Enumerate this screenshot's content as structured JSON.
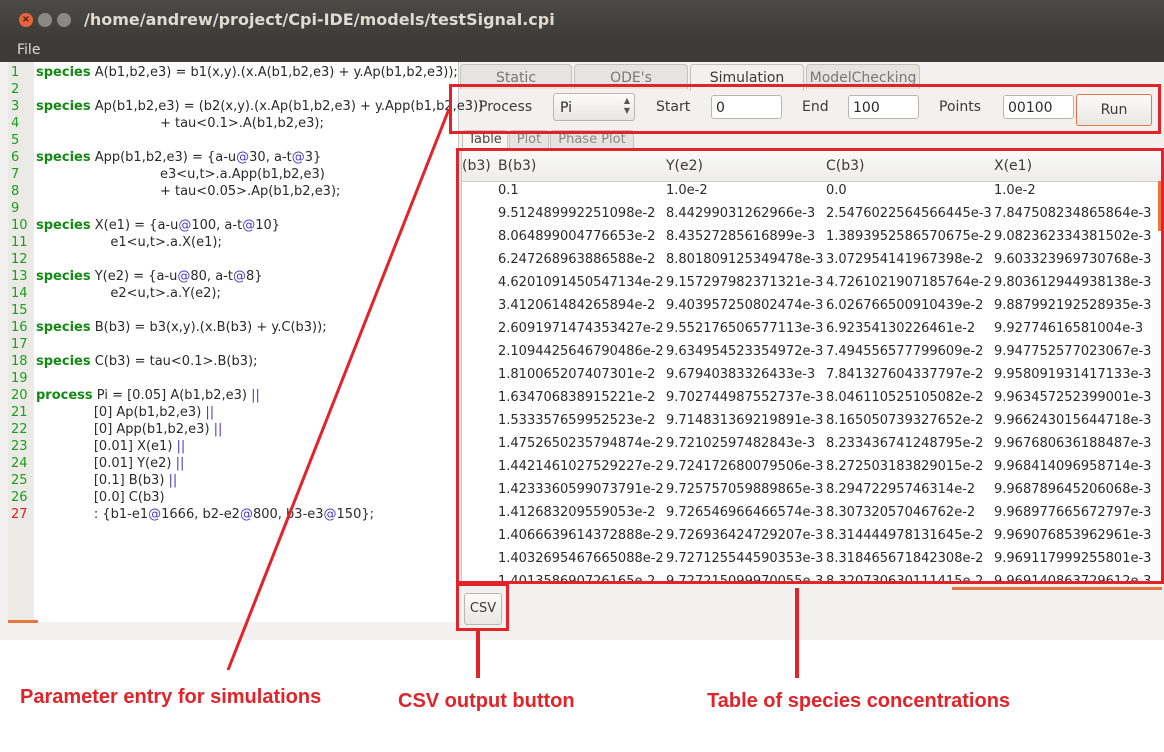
{
  "window": {
    "title": "/home/andrew/project/Cpi-IDE/models/testSignal.cpi",
    "menu": [
      "File"
    ]
  },
  "editor": {
    "lines": [
      {
        "n": "1",
        "html": "<span class='kw'>species</span> A(b1,b2,e3) = b1(x,y).(x.A(b1,b2,e3) + y.Ap(b1,b2,e3));"
      },
      {
        "n": "2",
        "html": ""
      },
      {
        "n": "3",
        "html": "<span class='kw'>species</span> Ap(b1,b2,e3) = (b2(x,y).(x.Ap(b1,b2,e3) + y.App(b1,b2,e3))"
      },
      {
        "n": "4",
        "html": "                              + tau&lt;0.1&gt;.A(b1,b2,e3);"
      },
      {
        "n": "5",
        "html": ""
      },
      {
        "n": "6",
        "html": "<span class='kw'>species</span> App(b1,b2,e3) = {a-u<span class='op'>@</span>30, a-t<span class='op'>@</span>3}"
      },
      {
        "n": "7",
        "html": "                              e3&lt;u,t&gt;.a.App(b1,b2,e3)"
      },
      {
        "n": "8",
        "html": "                              + tau&lt;0.05&gt;.Ap(b1,b2,e3);"
      },
      {
        "n": "9",
        "html": ""
      },
      {
        "n": "10",
        "html": "<span class='kw'>species</span> X(e1) = {a-u<span class='op'>@</span>100, a-t<span class='op'>@</span>10}"
      },
      {
        "n": "11",
        "html": "                  e1&lt;u,t&gt;.a.X(e1);"
      },
      {
        "n": "12",
        "html": ""
      },
      {
        "n": "13",
        "html": "<span class='kw'>species</span> Y(e2) = {a-u<span class='op'>@</span>80, a-t<span class='op'>@</span>8}"
      },
      {
        "n": "14",
        "html": "                  e2&lt;u,t&gt;.a.Y(e2);"
      },
      {
        "n": "15",
        "html": ""
      },
      {
        "n": "16",
        "html": "<span class='kw'>species</span> B(b3) = b3(x,y).(x.B(b3) + y.C(b3));"
      },
      {
        "n": "17",
        "html": ""
      },
      {
        "n": "18",
        "html": "<span class='kw'>species</span> C(b3) = tau&lt;0.1&gt;.B(b3);"
      },
      {
        "n": "19",
        "html": ""
      },
      {
        "n": "20",
        "html": "<span class='kw'>process</span> Pi = [0.05] A(b1,b2,e3) <span class='op'>||</span>"
      },
      {
        "n": "21",
        "html": "              [0] Ap(b1,b2,e3) <span class='op'>||</span>"
      },
      {
        "n": "22",
        "html": "              [0] App(b1,b2,e3) <span class='op'>||</span>"
      },
      {
        "n": "23",
        "html": "              [0.01] X(e1) <span class='op'>||</span>"
      },
      {
        "n": "24",
        "html": "              [0.01] Y(e2) <span class='op'>||</span>"
      },
      {
        "n": "25",
        "html": "              [0.1] B(b3) <span class='op'>||</span>"
      },
      {
        "n": "26",
        "html": "              [0.0] C(b3)"
      },
      {
        "n": "27",
        "html": "              : {b1-e1<span class='op'>@</span>1666, b2-e2<span class='op'>@</span>800, b3-e3<span class='op'>@</span>150};"
      }
    ]
  },
  "tabs": [
    "Static",
    "ODE's",
    "Simulation",
    "ModelChecking"
  ],
  "params": {
    "process_label": "Process",
    "process_value": "Pi",
    "start_label": "Start",
    "start_value": "0",
    "end_label": "End",
    "end_value": "100",
    "points_label": "Points",
    "points_value": "00100",
    "run_label": "Run"
  },
  "subtabs": [
    "Table",
    "Plot",
    "Phase Plot"
  ],
  "table": {
    "columns": [
      "(b3)",
      "B(b3)",
      "Y(e2)",
      "C(b3)",
      "X(e1)"
    ],
    "rows": [
      [
        "",
        "0.1",
        "1.0e-2",
        "0.0",
        "1.0e-2"
      ],
      [
        "",
        "9.512489992251098e-2",
        "8.44299031262966e-3",
        "2.5476022564566445e-3",
        "7.847508234865864e-3"
      ],
      [
        "",
        "8.064899004776653e-2",
        "8.43527285616899e-3",
        "1.3893952586570675e-2",
        "9.082362334381502e-3"
      ],
      [
        "",
        "6.247268963886588e-2",
        "8.801809125349478e-3",
        "3.072954141967398e-2",
        "9.603323969730768e-3"
      ],
      [
        "",
        "4.6201091450547134e-2",
        "9.157297982371321e-3",
        "4.7261021907185764e-2",
        "9.803612944938138e-3"
      ],
      [
        "",
        "3.412061484265894e-2",
        "9.403957250802474e-3",
        "6.026766500910439e-2",
        "9.887992192528935e-3"
      ],
      [
        "",
        "2.6091971474353427e-2",
        "9.552176506577113e-3",
        "6.92354130226461e-2",
        "9.92774616581004e-3"
      ],
      [
        "",
        "2.1094425646790486e-2",
        "9.634954523354972e-3",
        "7.494556577799609e-2",
        "9.947752577023067e-3"
      ],
      [
        "",
        "1.810065207407301e-2",
        "9.67940383326433e-3",
        "7.841327604337797e-2",
        "9.958091931417133e-3"
      ],
      [
        "",
        "1.634706838915221e-2",
        "9.702744987552737e-3",
        "8.046110525105082e-2",
        "9.963457252399001e-3"
      ],
      [
        "",
        "1.533357659952523e-2",
        "9.714831369219891e-3",
        "8.165050739327652e-2",
        "9.966243015644718e-3"
      ],
      [
        "",
        "1.4752650235794874e-2",
        "9.72102597482843e-3",
        "8.233436741248795e-2",
        "9.967680636188487e-3"
      ],
      [
        "",
        "1.4421461027529227e-2",
        "9.724172680079506e-3",
        "8.272503183829015e-2",
        "9.968414096958714e-3"
      ],
      [
        "",
        "1.4233360599073791e-2",
        "9.725757059889865e-3",
        "8.29472295746314e-2",
        "9.968789645206068e-3"
      ],
      [
        "",
        "1.412683209559053e-2",
        "9.726546966466574e-3",
        "8.30732057046762e-2",
        "9.968977665672797e-3"
      ],
      [
        "",
        "1.4066639614372888e-2",
        "9.726936424729207e-3",
        "8.314444978131645e-2",
        "9.969076853962961e-3"
      ],
      [
        "",
        "1.4032695467665088e-2",
        "9.727125544590353e-3",
        "8.318465671842308e-2",
        "9.969117999255801e-3"
      ],
      [
        "",
        "1.401358690726165e-2",
        "9.727215099970055e-3",
        "8.320730630111415e-2",
        "9.969140863729612e-3"
      ]
    ]
  },
  "csv_label": "CSV",
  "annotations": {
    "params": "Parameter entry for simulations",
    "csv": "CSV output button",
    "table": "Table of species concentrations"
  },
  "colors": {
    "highlight": "#e2232a",
    "accent": "#e8763f",
    "keyword": "#148a14",
    "operator": "#4b3bbf"
  }
}
